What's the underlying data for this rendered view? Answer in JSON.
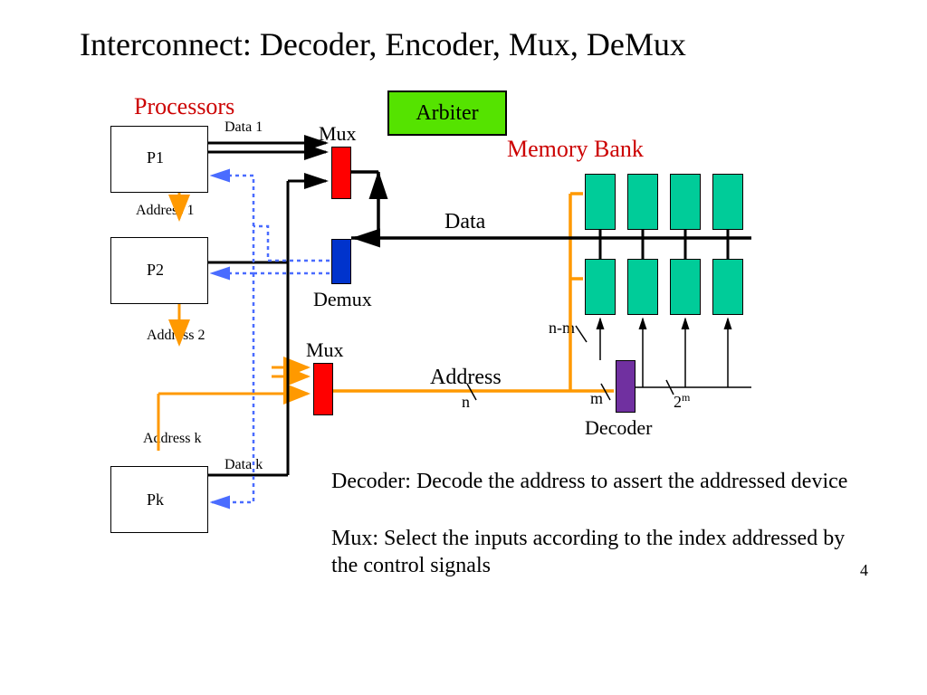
{
  "title": "Interconnect: Decoder, Encoder, Mux, DeMux",
  "labels": {
    "processors": "Processors",
    "memory_bank": "Memory Bank",
    "arbiter": "Arbiter",
    "mux1": "Mux",
    "mux2": "Mux",
    "demux": "Demux",
    "data": "Data",
    "address": "Address",
    "decoder": "Decoder",
    "p1": "P1",
    "p2": "P2",
    "pk": "Pk",
    "data1": "Data 1",
    "datak": "Data k",
    "addr1": "Address 1",
    "addr2": "Address 2",
    "addrk": "Address k",
    "n": "n",
    "m": "m",
    "nm": "n-m",
    "two_m_base": "2",
    "two_m_exp": "m"
  },
  "body": {
    "line1": "Decoder: Decode the address to assert the addressed device",
    "line2": "Mux: Select the inputs according to the index addressed by the control signals"
  },
  "page_number": "4",
  "colors": {
    "accent_red": "#cc0000",
    "arbiter_green": "#55e300",
    "mux_red": "#ff0000",
    "demux_blue": "#0033cc",
    "decoder_purple": "#7030a0",
    "memory_teal": "#00cc99",
    "orange": "#ff9900",
    "dotted_blue": "#4a6cff"
  }
}
